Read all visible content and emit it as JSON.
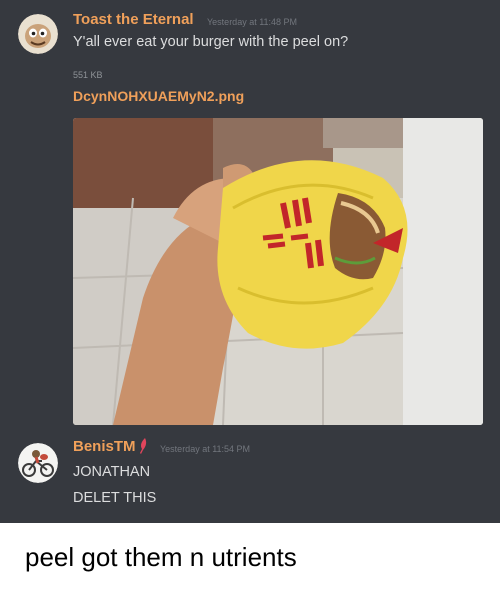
{
  "messages": [
    {
      "username": "Toast the Eternal",
      "timestamp": "Yesterday at 11:48 PM",
      "text": "Y'all ever eat your burger with the peel on?",
      "attachment": {
        "size": "551 KB",
        "filename": "DcynNOHXUAEMyN2.png"
      }
    },
    {
      "username": "BenisTM",
      "timestamp": "Yesterday at 11:54 PM",
      "lines": [
        "JONATHAN",
        "DELET THIS"
      ]
    }
  ],
  "caption": "peel got them n utrients",
  "colors": {
    "chat_background": "#36393f",
    "username_first": "#f0a05a",
    "username_second": "#f0a05a",
    "message_text": "#dcddde",
    "timestamp": "#72767d",
    "filename_link": "#f0a05a"
  },
  "icons": {
    "avatar_first": "cartoon-avatar-icon",
    "avatar_second": "cyclist-avatar-icon",
    "badge": "feather-quill-icon"
  }
}
